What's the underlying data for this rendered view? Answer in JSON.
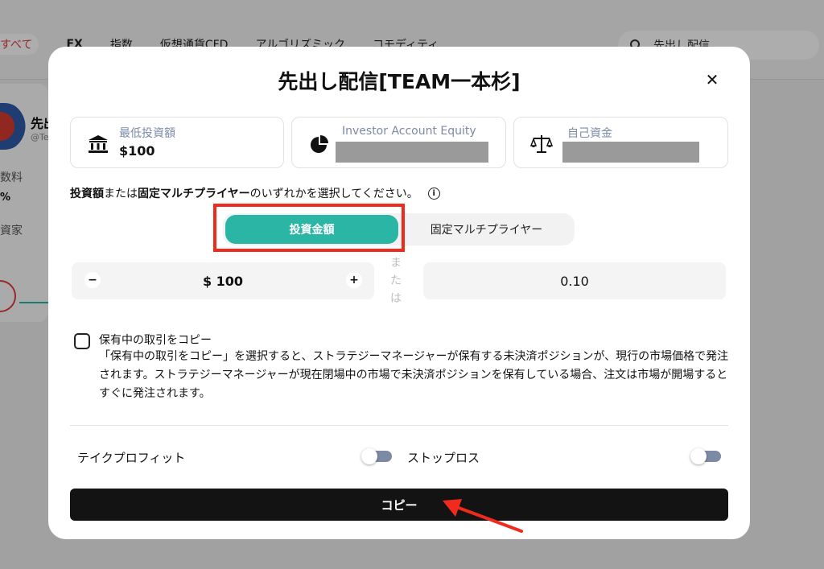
{
  "background": {
    "tabs": [
      {
        "label": "すべて",
        "active": true
      },
      {
        "label": "FX",
        "active": false
      },
      {
        "label": "指数",
        "active": false
      },
      {
        "label": "仮想通貨CFD",
        "active": false
      },
      {
        "label": "アルゴリズミック",
        "active": false
      },
      {
        "label": "コモディティ",
        "active": false
      }
    ],
    "search_text": "先出し配信",
    "card": {
      "name": "先出",
      "handle": "@Te",
      "label1": "数料",
      "label2": "%",
      "label3": "資家"
    }
  },
  "modal": {
    "title": "先出し配信[TEAM一本杉]",
    "close_glyph": "✕",
    "info_cards": {
      "min_investment": {
        "label": "最低投資額",
        "value": "$100"
      },
      "investor_equity": {
        "label": "Investor Account Equity"
      },
      "own_capital": {
        "label": "自己資金"
      }
    },
    "select_note": {
      "part1": "投資額",
      "part2": "または",
      "part3": "固定マルチプライヤー",
      "part4": "のいずれかを選択してください。",
      "info_glyph": "i"
    },
    "mode_toggle": {
      "active_label": "投資金額",
      "inactive_label": "固定マルチプライヤー"
    },
    "amount_stepper": {
      "minus": "−",
      "plus": "+",
      "value": "$ 100"
    },
    "or_vertical": [
      "ま",
      "た",
      "は"
    ],
    "multiplier_value": "0.10",
    "copy_holdings": {
      "title": "保有中の取引をコピー",
      "description": "「保有中の取引をコピー」を選択すると、ストラテジーマネージャーが保有する未決済ポジションが、現行の市場価格で発注されます。ストラテジーマネージャーが現在閉場中の市場で未決済ポジションを保有している場合、注文は市場が開場するとすぐに発注されます。",
      "checked": false
    },
    "take_profit": {
      "label": "テイクプロフィット",
      "enabled": false
    },
    "stop_loss": {
      "label": "ストップロス",
      "enabled": false
    },
    "copy_button_label": "コピー"
  },
  "colors": {
    "accent_teal": "#2bb5a5",
    "highlight_red": "#f02a1c",
    "label_blue_gray": "#7b8aa8",
    "button_black": "#131313"
  },
  "icons": {
    "min_investment": "bank-icon",
    "investor_equity": "pie-chart-icon",
    "own_capital": "balance-scale-icon",
    "search": "search-icon"
  }
}
